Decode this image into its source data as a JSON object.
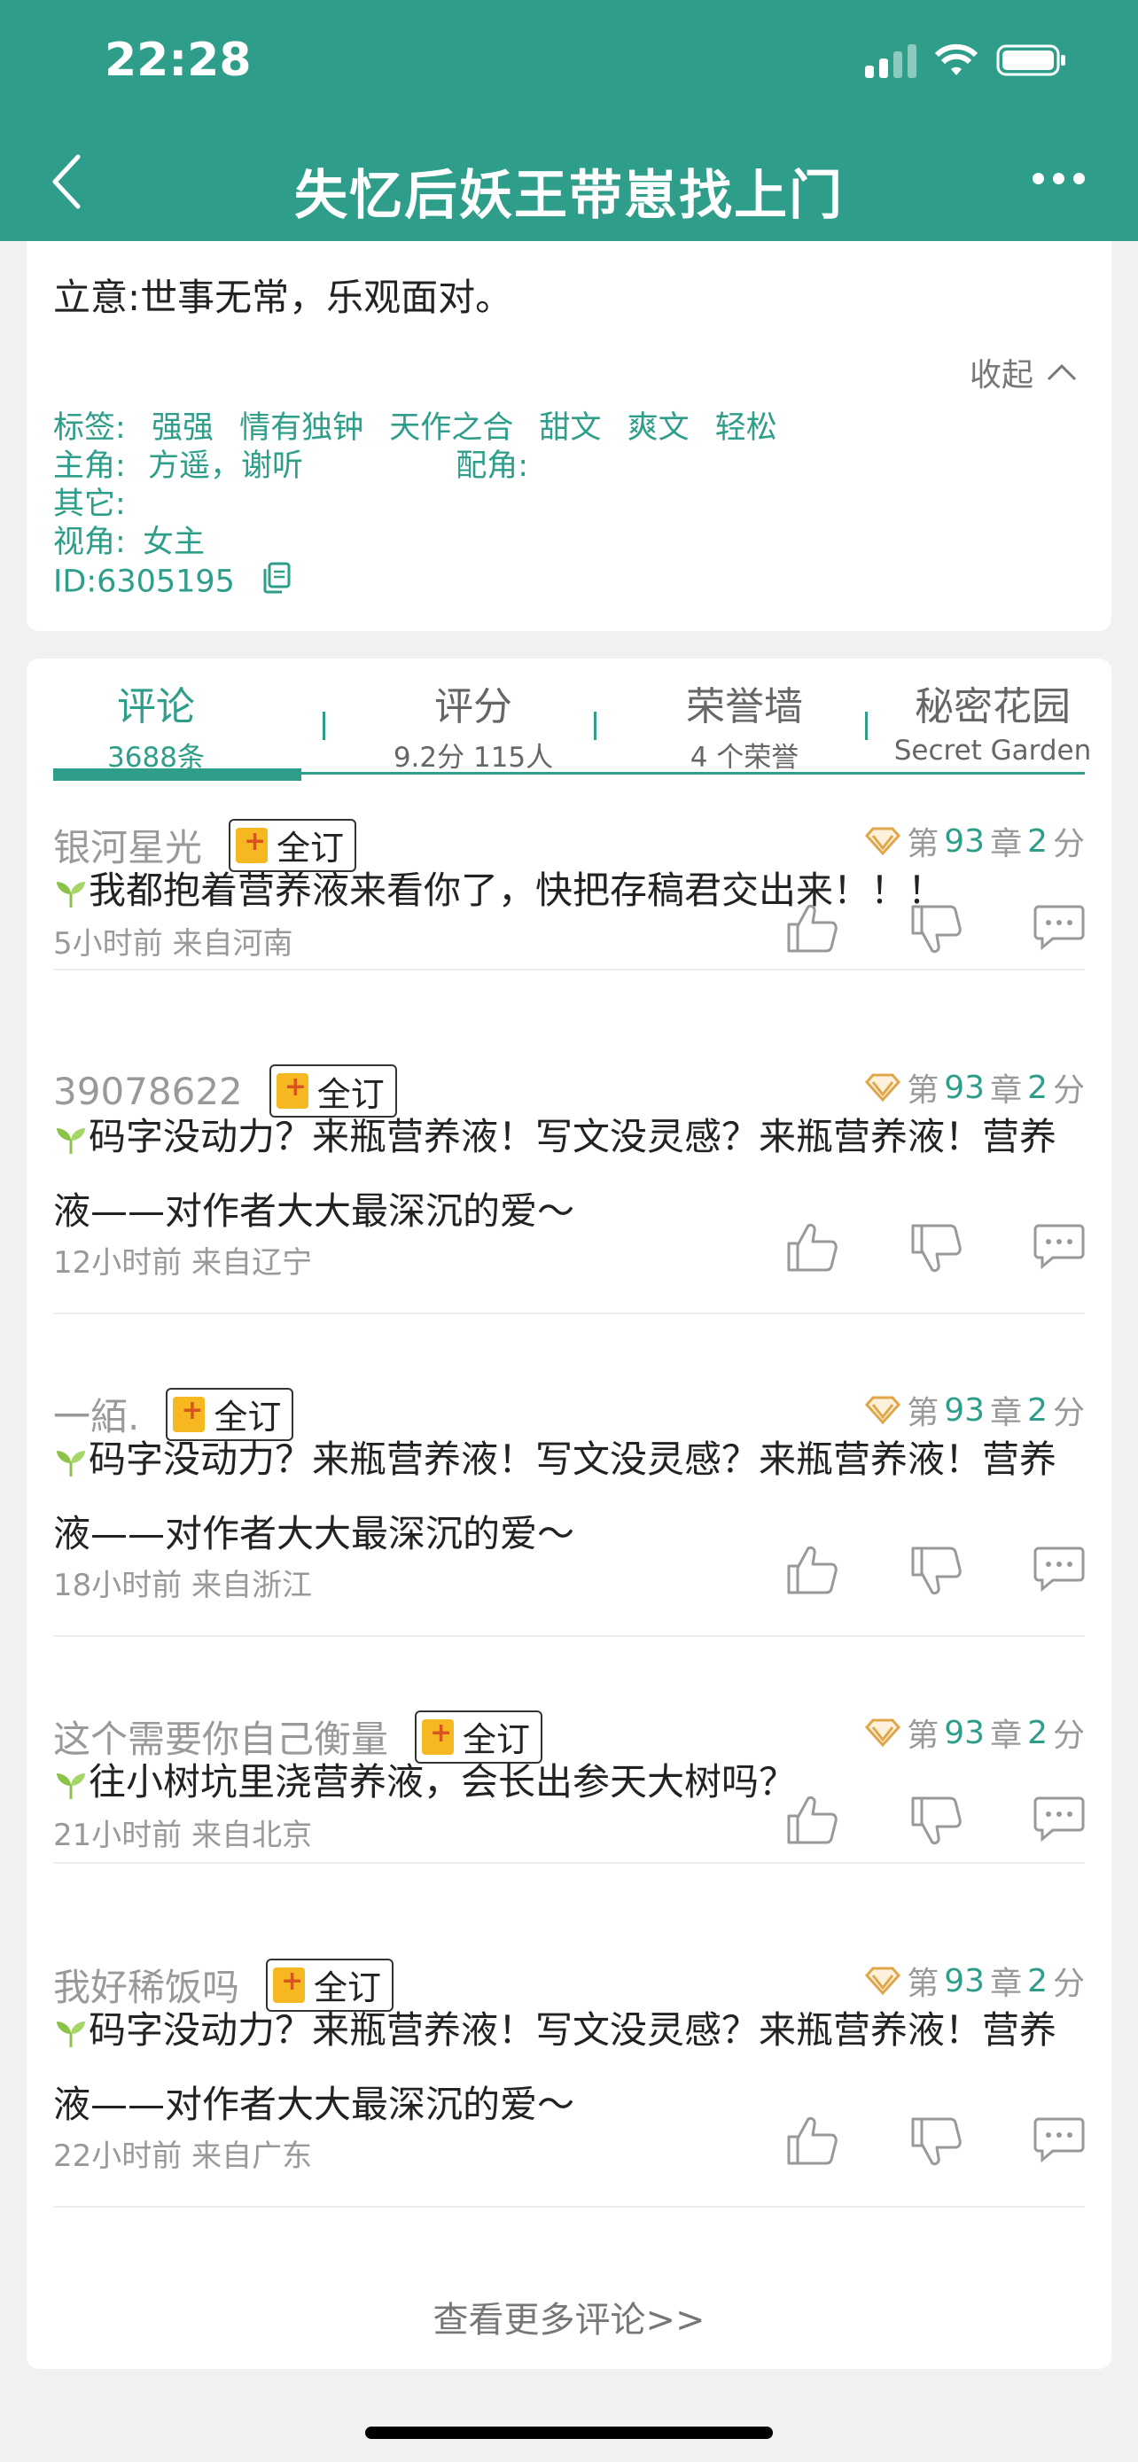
{
  "status": {
    "time": "22:28"
  },
  "header": {
    "title": "失忆后妖王带崽找上门"
  },
  "info": {
    "intent": "立意:世事无常，乐观面对。",
    "collapse_label": "收起",
    "tags_label": "标签:",
    "tags": [
      "强强",
      "情有独钟",
      "天作之合",
      "甜文",
      "爽文",
      "轻松"
    ],
    "lead_label": "主角:",
    "lead": "方遥，谢听",
    "support_label": "配角:",
    "other_label": "其它:",
    "pov_label": "视角:",
    "pov": "女主",
    "id": "ID:6305195"
  },
  "tabs": [
    {
      "label": "评论",
      "sub": "3688条"
    },
    {
      "label": "评分",
      "sub": "9.2分 115人"
    },
    {
      "label": "荣誉墙",
      "sub": "4 个荣誉"
    },
    {
      "label": "秘密花园",
      "sub": "Secret Garden"
    }
  ],
  "badge_label": "全订",
  "chapter_prefix": "第",
  "chapter_mid": "章",
  "score_suffix": "分",
  "comments": [
    {
      "user": "银河星光",
      "chapter": "93",
      "score": "2",
      "text": "我都抱着营养液来看你了，快把存稿君交出来！！！",
      "time": "5小时前  来自河南"
    },
    {
      "user": "39078622",
      "chapter": "93",
      "score": "2",
      "text": "码字没动力？来瓶营养液！写文没灵感？来瓶营养液！营养液——对作者大大最深沉的爱～",
      "time": "12小时前  来自辽宁"
    },
    {
      "user": "一絔.",
      "chapter": "93",
      "score": "2",
      "text": "码字没动力？来瓶营养液！写文没灵感？来瓶营养液！营养液——对作者大大最深沉的爱～",
      "time": "18小时前  来自浙江"
    },
    {
      "user": "这个需要你自己衡量",
      "chapter": "93",
      "score": "2",
      "text": "往小树坑里浇营养液，会长出参天大树吗？",
      "time": "21小时前  来自北京"
    },
    {
      "user": "我好稀饭吗",
      "chapter": "93",
      "score": "2",
      "text": "码字没动力？来瓶营养液！写文没灵感？来瓶营养液！营养液——对作者大大最深沉的爱～",
      "time": "22小时前  来自广东"
    }
  ],
  "more_comments": "查看更多评论>>"
}
